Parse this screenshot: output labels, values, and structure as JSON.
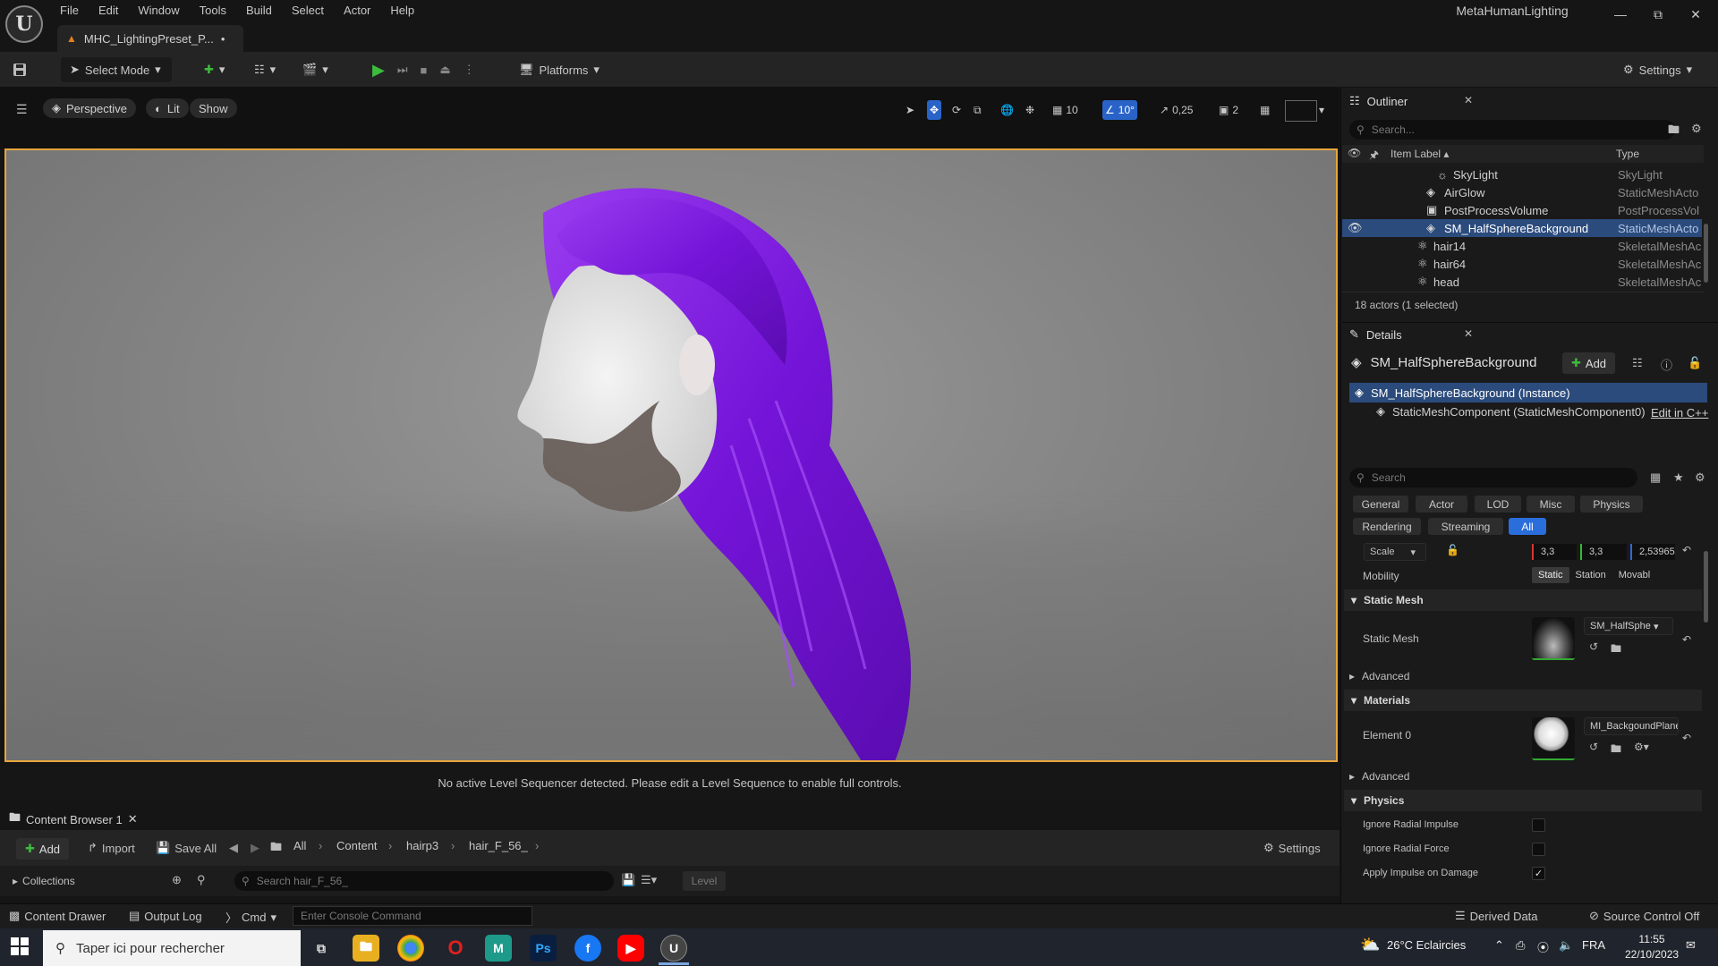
{
  "app": {
    "project_name": "MetaHumanLighting",
    "logo_text": "U"
  },
  "menu": [
    "File",
    "Edit",
    "Window",
    "Tools",
    "Build",
    "Select",
    "Actor",
    "Help"
  ],
  "doc_tab": {
    "label": "MHC_LightingPreset_P...",
    "dirty": "•"
  },
  "toolbar": {
    "select_mode": "Select Mode",
    "platforms": "Platforms",
    "settings": "Settings"
  },
  "viewport": {
    "perspective": "Perspective",
    "lit": "Lit",
    "show": "Show",
    "grid_snap": "10",
    "angle_snap": "10°",
    "scale_snap": "0,25",
    "camera_speed": "2",
    "sequencer_message": "No active Level Sequencer detected. Please edit a Level Sequence to enable full controls."
  },
  "content_browser": {
    "tab_label": "Content Browser 1",
    "add": "Add",
    "import": "Import",
    "save_all": "Save All",
    "breadcrumb": [
      "All",
      "Content",
      "hairp3",
      "hair_F_56_"
    ],
    "settings": "Settings",
    "collections": "Collections",
    "search_placeholder": "Search hair_F_56_",
    "level_chip": "Level"
  },
  "statusbar": {
    "content_drawer": "Content Drawer",
    "output_log": "Output Log",
    "cmd": "Cmd",
    "console_placeholder": "Enter Console Command",
    "derived_data": "Derived Data",
    "source_control": "Source Control Off"
  },
  "outliner": {
    "title": "Outliner",
    "search_placeholder": "Search...",
    "col_label": "Item Label",
    "col_type": "Type",
    "rows": [
      {
        "label": "SkyLight",
        "type": "SkyLight",
        "indent": 2,
        "icon": "skylight-icon"
      },
      {
        "label": "AirGlow",
        "type": "StaticMeshActo",
        "indent": 1,
        "icon": "static-mesh-icon"
      },
      {
        "label": "PostProcessVolume",
        "type": "PostProcessVol",
        "indent": 1,
        "icon": "volume-icon"
      },
      {
        "label": "SM_HalfSphereBackground",
        "type": "StaticMeshActo",
        "indent": 1,
        "icon": "static-mesh-icon",
        "selected": true
      },
      {
        "label": "hair14",
        "type": "SkeletalMeshAc",
        "indent": 0,
        "icon": "skeletal-mesh-icon"
      },
      {
        "label": "hair64",
        "type": "SkeletalMeshAc",
        "indent": 0,
        "icon": "skeletal-mesh-icon"
      },
      {
        "label": "head",
        "type": "SkeletalMeshAc",
        "indent": 0,
        "icon": "skeletal-mesh-icon"
      }
    ],
    "footer": "18 actors (1 selected)"
  },
  "details": {
    "title": "Details",
    "actor_name": "SM_HalfSphereBackground",
    "add": "Add",
    "instance": "SM_HalfSphereBackground (Instance)",
    "component": "StaticMeshComponent (StaticMeshComponent0)",
    "edit_cpp": "Edit in C++",
    "search_placeholder": "Search",
    "categories_row1": [
      "General",
      "Actor",
      "LOD",
      "Misc",
      "Physics"
    ],
    "categories_row2": [
      "Rendering",
      "Streaming",
      "All"
    ],
    "active_category": "All",
    "scale_label": "Scale",
    "scale_values": [
      "3,3",
      "3,3",
      "2,53965"
    ],
    "mobility_label": "Mobility",
    "mobility_options": [
      "Static",
      "Station",
      "Movabl"
    ],
    "sections": {
      "static_mesh": "Static Mesh",
      "static_mesh_prop": "Static Mesh",
      "static_mesh_asset": "SM_HalfSphe",
      "advanced": "Advanced",
      "materials": "Materials",
      "element0": "Element 0",
      "material_asset": "MI_BackgoundPlane",
      "advanced2": "Advanced",
      "physics": "Physics"
    },
    "physics_props": [
      {
        "label": "Ignore Radial Impulse",
        "checked": false
      },
      {
        "label": "Ignore Radial Force",
        "checked": false
      },
      {
        "label": "Apply Impulse on Damage",
        "checked": true
      }
    ]
  },
  "taskbar": {
    "search_placeholder": "Taper ici pour rechercher",
    "weather": "26°C Eclaircies",
    "language": "FRA",
    "time": "11:55",
    "date": "22/10/2023"
  },
  "colors": {
    "accent": "#2a6edc",
    "selection": "#2b4b7c",
    "viewport_border": "#e8a53c",
    "hair": "#7a18e0"
  }
}
